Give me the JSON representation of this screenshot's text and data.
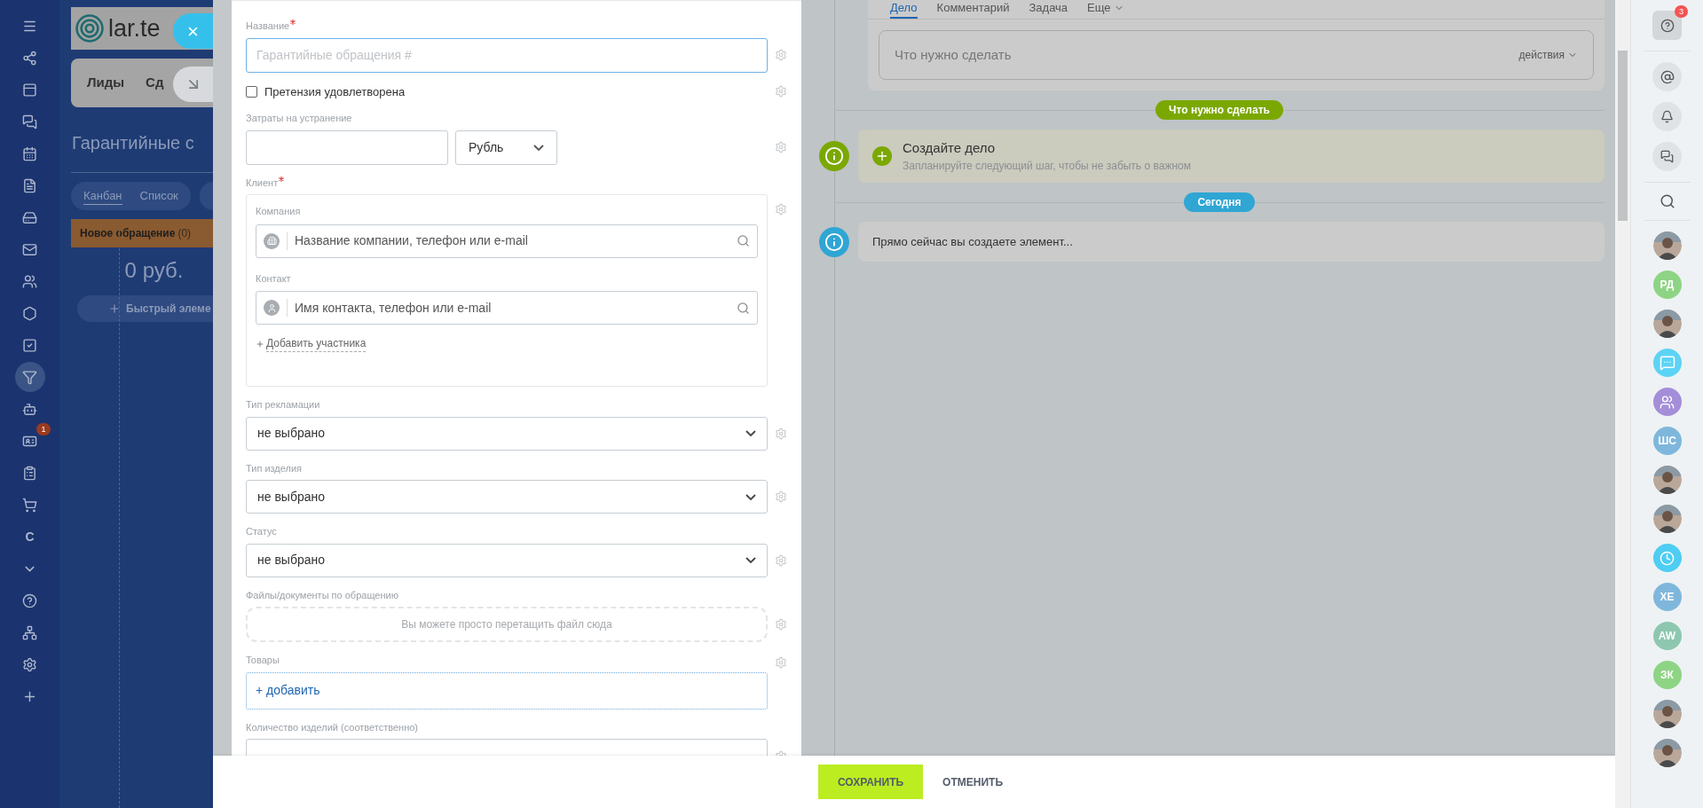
{
  "left_nav": {
    "items": [
      {
        "selected": false
      },
      {
        "selected": false
      },
      {
        "selected": false
      },
      {
        "selected": false
      },
      {
        "selected": false
      },
      {
        "selected": false
      },
      {
        "selected": false
      },
      {
        "selected": false
      },
      {
        "selected": false
      },
      {
        "selected": false
      },
      {
        "selected": false
      },
      {
        "selected": true
      },
      {
        "selected": false
      },
      {
        "selected": false,
        "badge": "1"
      },
      {
        "selected": false
      },
      {
        "selected": false
      },
      {
        "selected": false,
        "label": "С"
      },
      {
        "selected": false
      },
      {
        "selected": false
      },
      {
        "selected": false
      },
      {
        "selected": false
      },
      {
        "selected": false
      }
    ]
  },
  "background_page": {
    "logo_text": "lar.te",
    "top_tabs": [
      "Лиды",
      "Сд"
    ],
    "title": "Гарантийные с",
    "view_tabs": [
      {
        "label": "Канбан",
        "selected": true
      },
      {
        "label": "Список",
        "selected": false
      }
    ],
    "column": {
      "name": "Новое обращение",
      "count": "(0)",
      "sum": "0 руб.",
      "quick_add": "Быстрый элеме"
    }
  },
  "slider_controls": {
    "close": "×"
  },
  "form": {
    "fields": [
      {
        "kind": "text",
        "label": "Название",
        "required": true,
        "placeholder": "Гарантийные обращения #"
      },
      {
        "kind": "checkbox",
        "label": "Претензия удовлетворена",
        "checked": false
      },
      {
        "kind": "money",
        "label": "Затраты на устранение",
        "currency": "Рубль"
      },
      {
        "kind": "client",
        "label": "Клиент",
        "required": true,
        "company_label": "Компания",
        "company_placeholder": "Название компании, телефон или e-mail",
        "contact_label": "Контакт",
        "contact_placeholder": "Имя контакта, телефон или e-mail",
        "add_link": "Добавить участника"
      },
      {
        "kind": "select",
        "label": "Тип рекламации",
        "value": "не выбрано"
      },
      {
        "kind": "select",
        "label": "Тип изделия",
        "value": "не выбрано"
      },
      {
        "kind": "select",
        "label": "Статус",
        "value": "не выбрано"
      },
      {
        "kind": "files",
        "label": "Файлы/документы по обращению",
        "hint": "Вы можете просто перетащить файл сюда"
      },
      {
        "kind": "products",
        "label": "Товары",
        "add": "+ добавить"
      },
      {
        "kind": "text",
        "label": "Количество изделий (соответственно)",
        "required": false
      }
    ]
  },
  "timeline": {
    "tabs": [
      {
        "label": "Дело",
        "selected": true
      },
      {
        "label": "Комментарий",
        "selected": false
      },
      {
        "label": "Задача",
        "selected": false
      },
      {
        "label": "Еще",
        "selected": false
      }
    ],
    "todo_placeholder": "Что нужно сделать",
    "actions": "действия",
    "groups": [
      {
        "pill": "Что нужно сделать",
        "color": "#7ba800",
        "item": {
          "kind": "create",
          "title": "Создайте дело",
          "subtitle": "Запланируйте следующий шаг, чтобы не забыть о важном"
        }
      },
      {
        "pill": "Сегодня",
        "color": "#2fa6d4",
        "item": {
          "kind": "info",
          "title": "Прямо сейчас вы создаете элемент..."
        }
      }
    ]
  },
  "footer": {
    "save": "СОХРАНИТЬ",
    "cancel": "ОТМЕНИТЬ"
  },
  "right_bar": {
    "help_badge": "3",
    "avatars": [
      {
        "kind": "picture"
      },
      {
        "kind": "initials",
        "text": "РД",
        "color": "#8ed485"
      },
      {
        "kind": "picture"
      },
      {
        "kind": "chat",
        "color": "#5cd3f5"
      },
      {
        "kind": "group",
        "color": "#a48ed8"
      },
      {
        "kind": "initials",
        "text": "ШС",
        "color": "#7fb7dc"
      },
      {
        "kind": "picture"
      },
      {
        "kind": "picture"
      },
      {
        "kind": "clock",
        "color": "#4fcdf2"
      },
      {
        "kind": "initials",
        "text": "ХЕ",
        "color": "#7fb7dc"
      },
      {
        "kind": "initials",
        "text": "AW",
        "color": "#8ec7b0"
      },
      {
        "kind": "initials",
        "text": "ЗК",
        "color": "#8ed485"
      },
      {
        "kind": "picture"
      },
      {
        "kind": "picture"
      }
    ]
  }
}
